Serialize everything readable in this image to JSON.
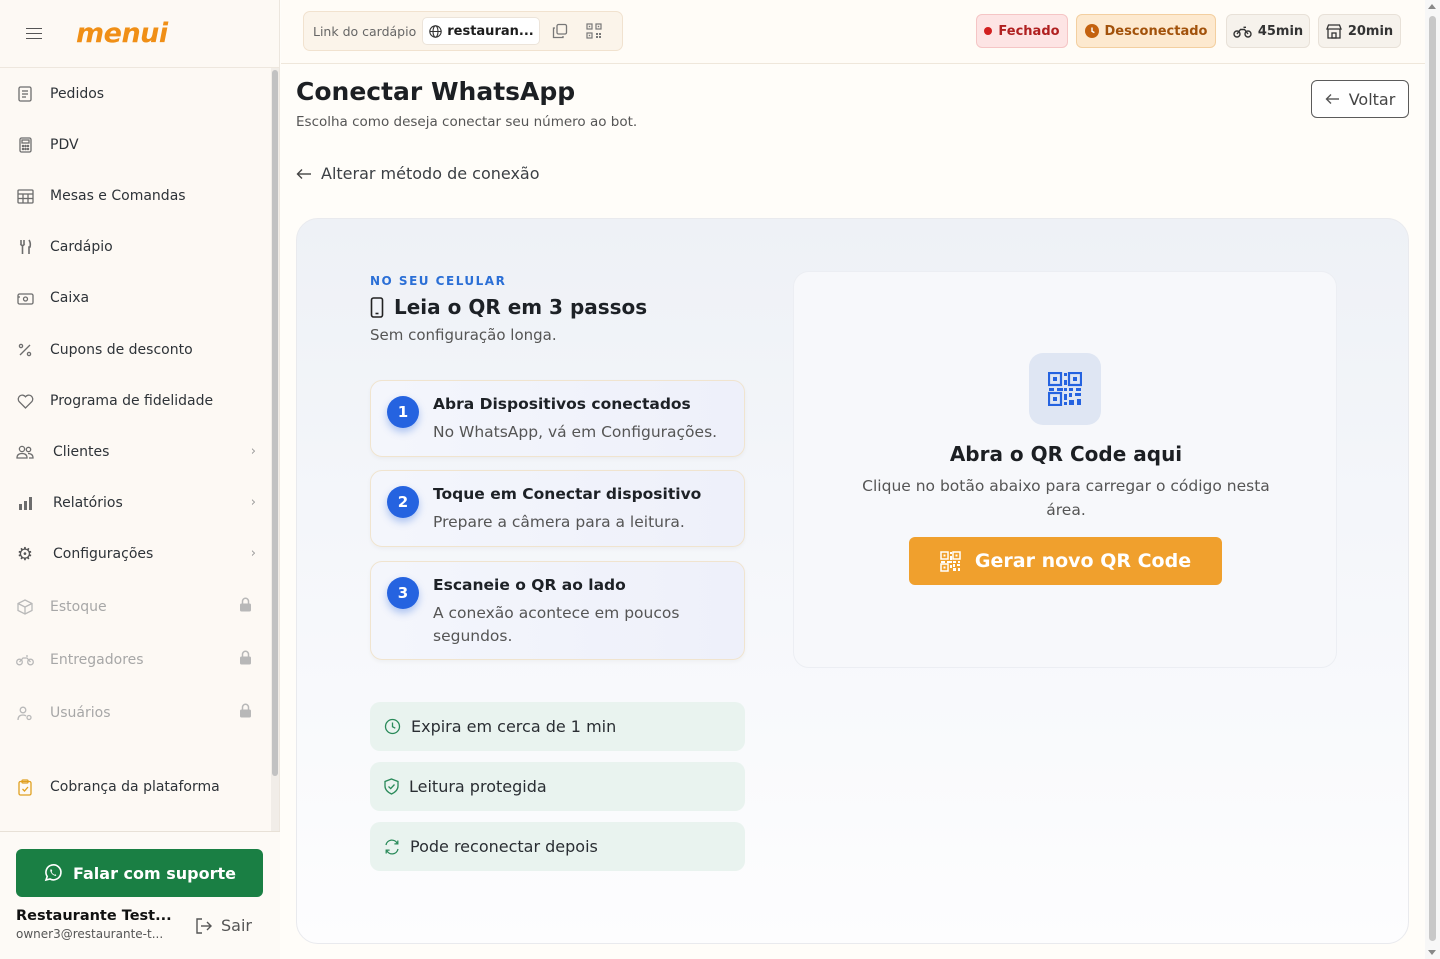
{
  "sidebar": {
    "logo": "menui",
    "items": [
      {
        "label": "Pedidos"
      },
      {
        "label": "PDV"
      },
      {
        "label": "Mesas e Comandas"
      },
      {
        "label": "Cardápio"
      },
      {
        "label": "Caixa"
      },
      {
        "label": "Cupons de desconto"
      },
      {
        "label": "Programa de fidelidade"
      },
      {
        "label": "Clientes"
      },
      {
        "label": "Relatórios"
      },
      {
        "label": "Configurações"
      },
      {
        "label": "Estoque"
      },
      {
        "label": "Entregadores"
      },
      {
        "label": "Usuários"
      },
      {
        "label": "Cobrança da plataforma"
      }
    ],
    "support_label": "Falar com suporte",
    "user_name": "Restaurante Test...",
    "user_email": "owner3@restaurante-t...",
    "logout_label": "Sair"
  },
  "topbar": {
    "link_label": "Link do cardápio",
    "link_value": "restauran...",
    "status_closed": "Fechado",
    "status_disconnected": "Desconectado",
    "delivery_time": "45min",
    "pickup_time": "20min"
  },
  "page": {
    "title": "Conectar WhatsApp",
    "subtitle": "Escolha como deseja conectar seu número ao bot.",
    "back_label": "Voltar",
    "change_method_label": "Alterar método de conexão"
  },
  "guide": {
    "eyebrow": "NO SEU CELULAR",
    "heading": "Leia o QR em 3 passos",
    "sub": "Sem configuração longa.",
    "steps": [
      {
        "num": "1",
        "title": "Abra Dispositivos conectados",
        "desc": "No WhatsApp, vá em Configurações."
      },
      {
        "num": "2",
        "title": "Toque em Conectar dispositivo",
        "desc": "Prepare a câmera para a leitura."
      },
      {
        "num": "3",
        "title": "Escaneie o QR ao lado",
        "desc": "A conexão acontece em poucos segundos."
      }
    ],
    "info": [
      {
        "label": "Expira em cerca de 1 min"
      },
      {
        "label": "Leitura protegida"
      },
      {
        "label": "Pode reconectar depois"
      }
    ]
  },
  "qr": {
    "title": "Abra o QR Code aqui",
    "desc": "Clique no botão abaixo para carregar o código nesta área.",
    "button_label": "Gerar novo QR Code"
  },
  "colors": {
    "brand": "#f08f16",
    "primary_blue": "#2563e0",
    "support_green": "#1a7f44",
    "cta_orange": "#f0a02d"
  }
}
